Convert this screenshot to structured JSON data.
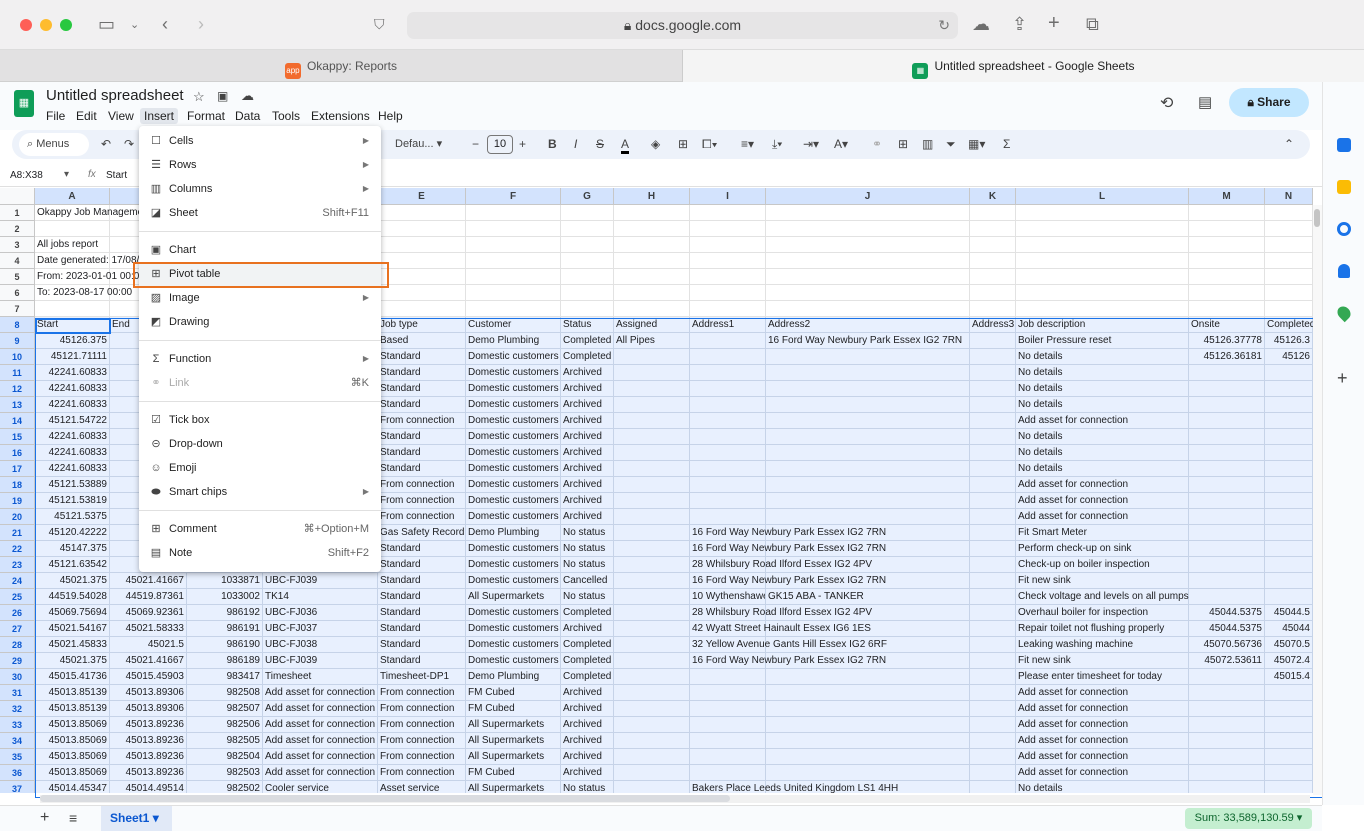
{
  "browser": {
    "url": "docs.google.com",
    "tabs": [
      {
        "label": "Okappy: Reports",
        "favicon": "app"
      },
      {
        "label": "Untitled spreadsheet - Google Sheets",
        "active": true
      }
    ]
  },
  "sheets": {
    "title": "Untitled spreadsheet",
    "menubar": [
      "File",
      "Edit",
      "View",
      "Insert",
      "Format",
      "Data",
      "Tools",
      "Extensions",
      "Help"
    ],
    "active_menu": "Insert",
    "share_label": "Share",
    "toolbar": {
      "search": "Menus",
      "font": "Defau...",
      "font_size": "10",
      "bold": "B",
      "italic": "I",
      "strike": "S",
      "text_color": "A",
      "sum": "Σ"
    },
    "name_box": "A8:X38",
    "formula": "Start",
    "columns": [
      "A",
      "B",
      "C",
      "D",
      "E",
      "F",
      "G",
      "H",
      "I",
      "J",
      "K",
      "L",
      "M",
      "N"
    ],
    "rows": [
      [
        "Okappy Job Manageme"
      ],
      [],
      [
        "All jobs report"
      ],
      [
        "Date generated: 17/08/"
      ],
      [
        "From: 2023-01-01 00:00"
      ],
      [
        "To: 2023-08-17 00:00"
      ],
      [],
      [
        "Start",
        "End",
        "",
        "",
        "Job type",
        "Customer",
        "Status",
        "Assigned",
        "Address1",
        "Address2",
        "Address3",
        "Job description",
        "Onsite",
        "Completed"
      ],
      [
        "45126.375",
        "45",
        "",
        "",
        "Based",
        "Demo Plumbing",
        "Completed",
        "All Pipes",
        "",
        "16 Ford Way  Newbury Park  Essex  IG2 7RN",
        "",
        "Boiler Pressure reset",
        "45126.37778",
        "45126.3"
      ],
      [
        "45121.71111",
        "45",
        "",
        "",
        "Standard",
        "Domestic customers",
        "Completed",
        "",
        "",
        "",
        "",
        "No details",
        "45126.36181",
        "45126"
      ],
      [
        "42241.60833",
        "",
        "",
        "",
        "Standard",
        "Domestic customers",
        "Archived",
        "",
        "",
        "",
        "",
        "No details",
        "",
        ""
      ],
      [
        "42241.60833",
        "",
        "",
        "",
        "Standard",
        "Domestic customers",
        "Archived",
        "",
        "",
        "",
        "",
        "No details",
        "",
        ""
      ],
      [
        "42241.60833",
        "",
        "",
        "",
        "Standard",
        "Domestic customers",
        "Archived",
        "",
        "",
        "",
        "",
        "No details",
        "",
        ""
      ],
      [
        "45121.54722",
        "45",
        "",
        "",
        "From connection",
        "Domestic customers",
        "Archived",
        "",
        "",
        "",
        "",
        "Add asset for connection",
        "",
        ""
      ],
      [
        "42241.60833",
        "",
        "",
        "",
        "Standard",
        "Domestic customers",
        "Archived",
        "",
        "",
        "",
        "",
        "No details",
        "",
        ""
      ],
      [
        "42241.60833",
        "",
        "",
        "",
        "Standard",
        "Domestic customers",
        "Archived",
        "",
        "",
        "",
        "",
        "No details",
        "",
        ""
      ],
      [
        "42241.60833",
        "",
        "",
        "",
        "Standard",
        "Domestic customers",
        "Archived",
        "",
        "",
        "",
        "",
        "No details",
        "",
        ""
      ],
      [
        "45121.53889",
        "45",
        "",
        "",
        "From connection",
        "Domestic customers",
        "Archived",
        "",
        "",
        "",
        "",
        "Add asset for connection",
        "",
        ""
      ],
      [
        "45121.53819",
        "45",
        "",
        "",
        "From connection",
        "Domestic customers",
        "Archived",
        "",
        "",
        "",
        "",
        "Add asset for connection",
        "",
        ""
      ],
      [
        "45121.5375",
        "45",
        "",
        "",
        "From connection",
        "Domestic customers",
        "Archived",
        "",
        "",
        "",
        "",
        "Add asset for connection",
        "",
        ""
      ],
      [
        "45120.42222",
        "45",
        "",
        "",
        "Gas Safety Record",
        "Demo Plumbing",
        "No status",
        "",
        "16 Ford Way  Newbury Park  Essex  IG2 7RN",
        "",
        "",
        "Fit Smart Meter",
        "",
        ""
      ],
      [
        "45147.375",
        "45",
        "",
        "",
        "Standard",
        "Domestic customers",
        "No status",
        "",
        "16 Ford Way  Newbury Park  Essex  IG2 7RN",
        "",
        "",
        "Perform check-up on sink",
        "",
        ""
      ],
      [
        "45121.63542",
        "45",
        "",
        "",
        "Standard",
        "Domestic customers",
        "No status",
        "",
        "28 Whilsbury Road  Ilford  Essex  IG2 4PV",
        "",
        "",
        "Check-up on boiler inspection",
        "",
        ""
      ],
      [
        "45021.375",
        "45021.41667",
        "1033871",
        "UBC-FJ039",
        "Standard",
        "Domestic customers",
        "Cancelled",
        "",
        "16 Ford Way  Newbury Park  Essex  IG2 7RN",
        "",
        "",
        "Fit new sink",
        "",
        ""
      ],
      [
        "44519.54028",
        "44519.87361",
        "1033002",
        "TK14",
        "Standard",
        "All Supermarkets",
        "No status",
        "",
        "10 Wythenshawe",
        "GK15 ABA - TANKER",
        "",
        "Check voltage and levels on all pumps",
        "",
        ""
      ],
      [
        "45069.75694",
        "45069.92361",
        "986192",
        "UBC-FJ036",
        "Standard",
        "Domestic customers",
        "Completed",
        "",
        "28 Whilsbury Road  Ilford  Essex  IG2 4PV",
        "",
        "",
        "Overhaul boiler for inspection",
        "45044.5375",
        "45044.5"
      ],
      [
        "45021.54167",
        "45021.58333",
        "986191",
        "UBC-FJ037",
        "Standard",
        "Domestic customers",
        "Archived",
        "",
        "42 Wyatt Street  Hainault  Essex  IG6 1ES",
        "",
        "",
        "Repair toilet not flushing properly",
        "45044.5375",
        "45044"
      ],
      [
        "45021.45833",
        "45021.5",
        "986190",
        "UBC-FJ038",
        "Standard",
        "Domestic customers",
        "Completed",
        "",
        "32 Yellow Avenue  Gants Hill  Essex  IG2 6RF",
        "",
        "",
        "Leaking washing machine",
        "45070.56736",
        "45070.5"
      ],
      [
        "45021.375",
        "45021.41667",
        "986189",
        "UBC-FJ039",
        "Standard",
        "Domestic customers",
        "Completed",
        "",
        "16 Ford Way  Newbury Park  Essex  IG2 7RN",
        "",
        "",
        "Fit new sink",
        "45072.53611",
        "45072.4"
      ],
      [
        "45015.41736",
        "45015.45903",
        "983417",
        "Timesheet",
        "Timesheet-DP1",
        "Demo Plumbing",
        "Completed",
        "",
        "",
        "",
        "",
        "Please enter timesheet for today",
        "",
        "45015.4"
      ],
      [
        "45013.85139",
        "45013.89306",
        "982508",
        "Add asset for connection",
        "From connection",
        "FM Cubed",
        "Archived",
        "",
        "",
        "",
        "",
        "Add asset for connection",
        "",
        ""
      ],
      [
        "45013.85139",
        "45013.89306",
        "982507",
        "Add asset for connection",
        "From connection",
        "FM Cubed",
        "Archived",
        "",
        "",
        "",
        "",
        "Add asset for connection",
        "",
        ""
      ],
      [
        "45013.85069",
        "45013.89236",
        "982506",
        "Add asset for connection",
        "From connection",
        "All Supermarkets",
        "Archived",
        "",
        "",
        "",
        "",
        "Add asset for connection",
        "",
        ""
      ],
      [
        "45013.85069",
        "45013.89236",
        "982505",
        "Add asset for connection",
        "From connection",
        "All Supermarkets",
        "Archived",
        "",
        "",
        "",
        "",
        "Add asset for connection",
        "",
        ""
      ],
      [
        "45013.85069",
        "45013.89236",
        "982504",
        "Add asset for connection",
        "From connection",
        "All Supermarkets",
        "Archived",
        "",
        "",
        "",
        "",
        "Add asset for connection",
        "",
        ""
      ],
      [
        "45013.85069",
        "45013.89236",
        "982503",
        "Add asset for connection",
        "From connection",
        "FM Cubed",
        "Archived",
        "",
        "",
        "",
        "",
        "Add asset for connection",
        "",
        ""
      ],
      [
        "45014.45347",
        "45014.49514",
        "982502",
        "Cooler service",
        "Asset service",
        "All Supermarkets",
        "No status",
        "",
        "Bakers Place  Leeds  United Kingdom  LS1 4HH",
        "",
        "",
        "No details",
        "",
        ""
      ]
    ],
    "insert_menu": [
      {
        "label": "Cells",
        "icon": "cells-icon",
        "submenu": true
      },
      {
        "label": "Rows",
        "icon": "rows-icon",
        "submenu": true
      },
      {
        "label": "Columns",
        "icon": "columns-icon",
        "submenu": true
      },
      {
        "label": "Sheet",
        "icon": "sheet-icon",
        "shortcut": "Shift+F11"
      },
      {
        "separator": true
      },
      {
        "label": "Chart",
        "icon": "chart-icon"
      },
      {
        "label": "Pivot table",
        "icon": "pivot-table-icon",
        "highlighted": true
      },
      {
        "label": "Image",
        "icon": "image-icon",
        "submenu": true
      },
      {
        "label": "Drawing",
        "icon": "drawing-icon"
      },
      {
        "separator": true
      },
      {
        "label": "Function",
        "icon": "function-icon",
        "submenu": true
      },
      {
        "label": "Link",
        "icon": "link-icon",
        "shortcut": "⌘K",
        "disabled": true
      },
      {
        "separator": true
      },
      {
        "label": "Tick box",
        "icon": "tick-box-icon"
      },
      {
        "label": "Drop-down",
        "icon": "drop-down-icon"
      },
      {
        "label": "Emoji",
        "icon": "emoji-icon"
      },
      {
        "label": "Smart chips",
        "icon": "smart-chips-icon",
        "submenu": true
      },
      {
        "separator": true
      },
      {
        "label": "Comment",
        "icon": "comment-icon",
        "shortcut": "⌘+Option+M"
      },
      {
        "label": "Note",
        "icon": "note-icon",
        "shortcut": "Shift+F2"
      }
    ],
    "sheet_tab": "Sheet1",
    "sum": "Sum: 33,589,130.59",
    "colors": {
      "accent": "#1a73e8",
      "selection": "#e8f0fe",
      "highlight_box": "#e8711f",
      "share": "#c2e7ff",
      "sum_badge": "#c4eed0"
    }
  }
}
